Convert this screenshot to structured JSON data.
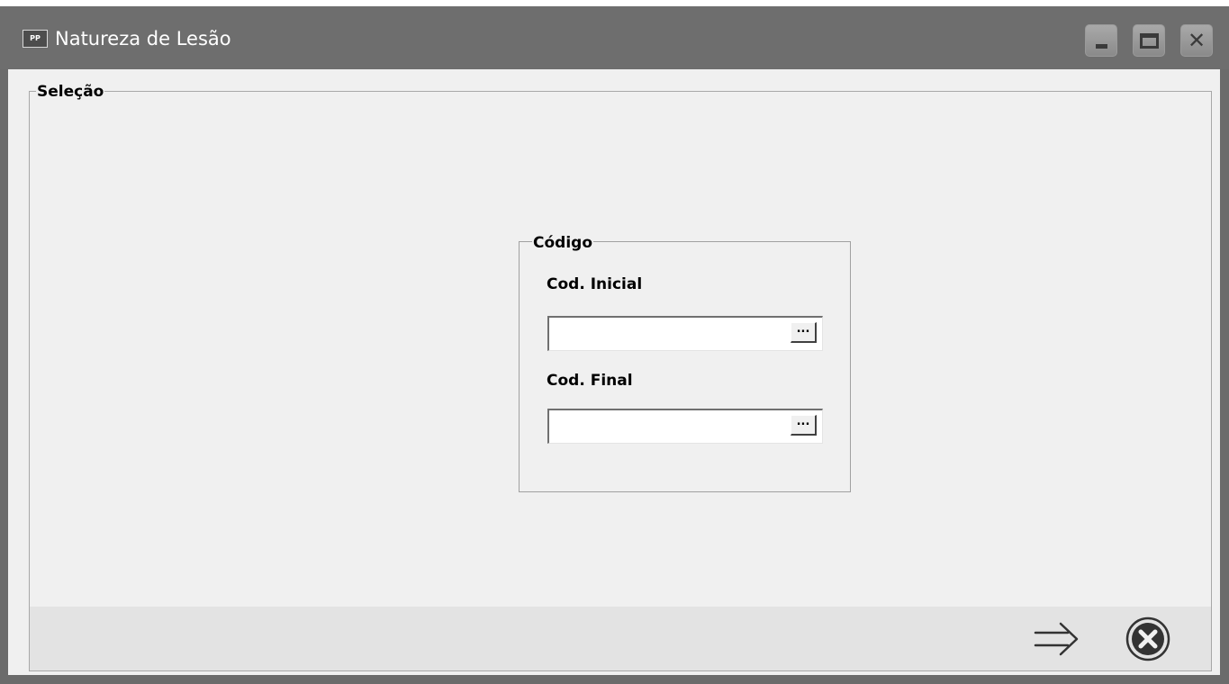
{
  "window": {
    "title": "Natureza de Lesão",
    "app_icon_text": "PP",
    "controls": {
      "minimize_icon": "minimize-icon",
      "maximize_icon": "maximize-icon",
      "close_icon": "close-icon",
      "close_glyph": "✕"
    }
  },
  "selection": {
    "legend": "Seleção"
  },
  "code_group": {
    "legend": "Código",
    "initial": {
      "label": "Cod. Inicial",
      "value": "",
      "lookup_label": "..."
    },
    "final": {
      "label": "Cod. Final",
      "value": "",
      "lookup_label": "..."
    }
  },
  "footer": {
    "next_icon": "arrow-right-icon",
    "cancel_icon": "cancel-circle-icon"
  },
  "colors": {
    "titlebar": "#6e6e6e",
    "client_bg": "#f0f0f0",
    "footer_bg": "#e3e3e3",
    "icon_dark": "#333333"
  }
}
